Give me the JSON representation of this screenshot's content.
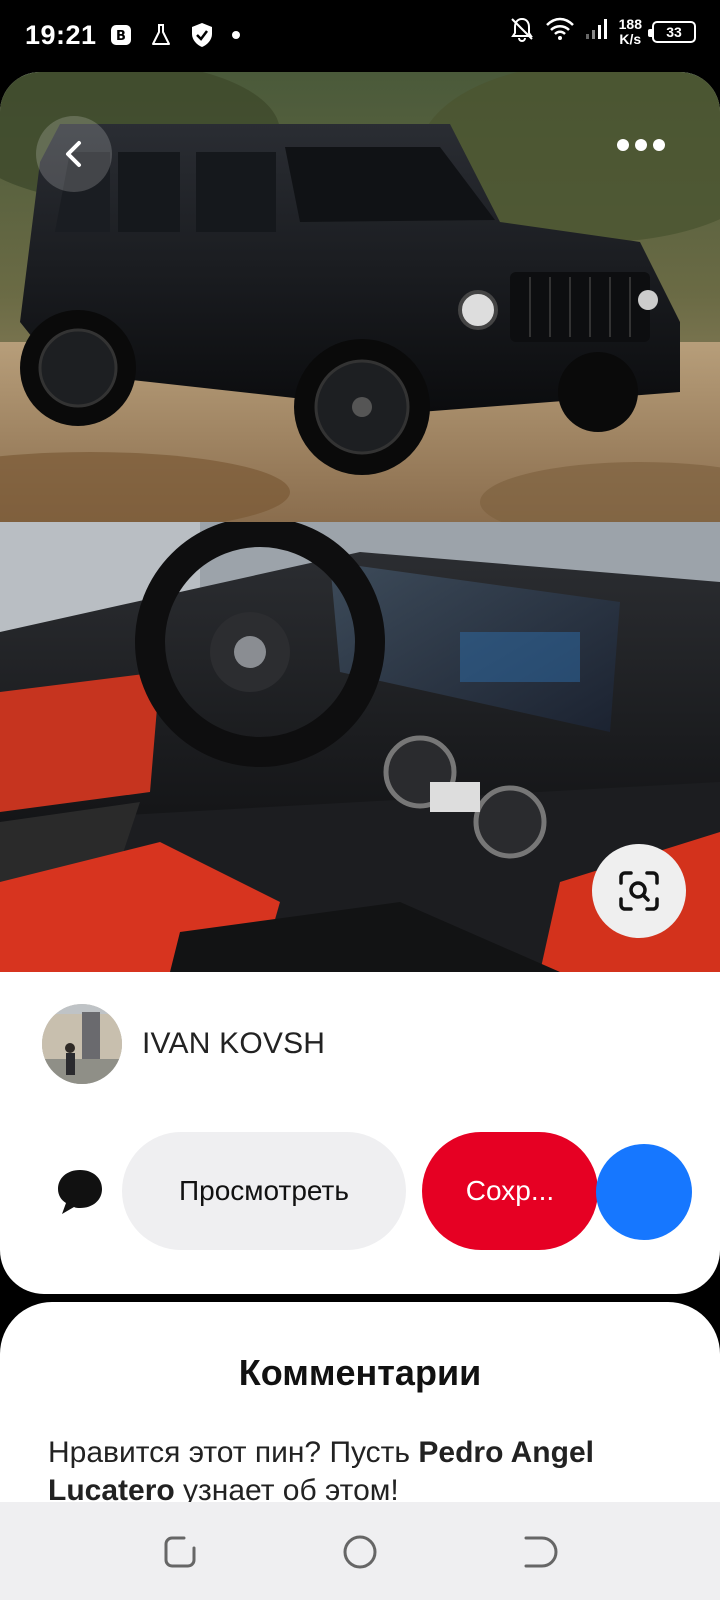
{
  "status_bar": {
    "time": "19:21",
    "speed_value": "188",
    "speed_unit": "K/s",
    "battery": "33",
    "icons": [
      "b-badge-icon",
      "flask-icon",
      "shield-check-icon",
      "dot-icon",
      "notifications-off-icon",
      "wifi-icon",
      "signal-icon",
      "battery-icon"
    ]
  },
  "pin": {
    "icons": [
      "back-icon",
      "more-icon",
      "visual-search-icon"
    ],
    "author_name": "IVAN KOVSH",
    "view_label": "Просмотреть",
    "save_label": "Сохр...",
    "accent": "#e60023",
    "share_color": "#1677ff"
  },
  "comments": {
    "title": "Комментарии",
    "prompt_before": "Нравится этот пин? Пусть ",
    "prompt_name": "Pedro Angel Lucatero",
    "prompt_after": " узнает об этом!"
  },
  "nav": {
    "icons": [
      "recent-apps-icon",
      "home-icon",
      "back-nav-icon"
    ]
  }
}
